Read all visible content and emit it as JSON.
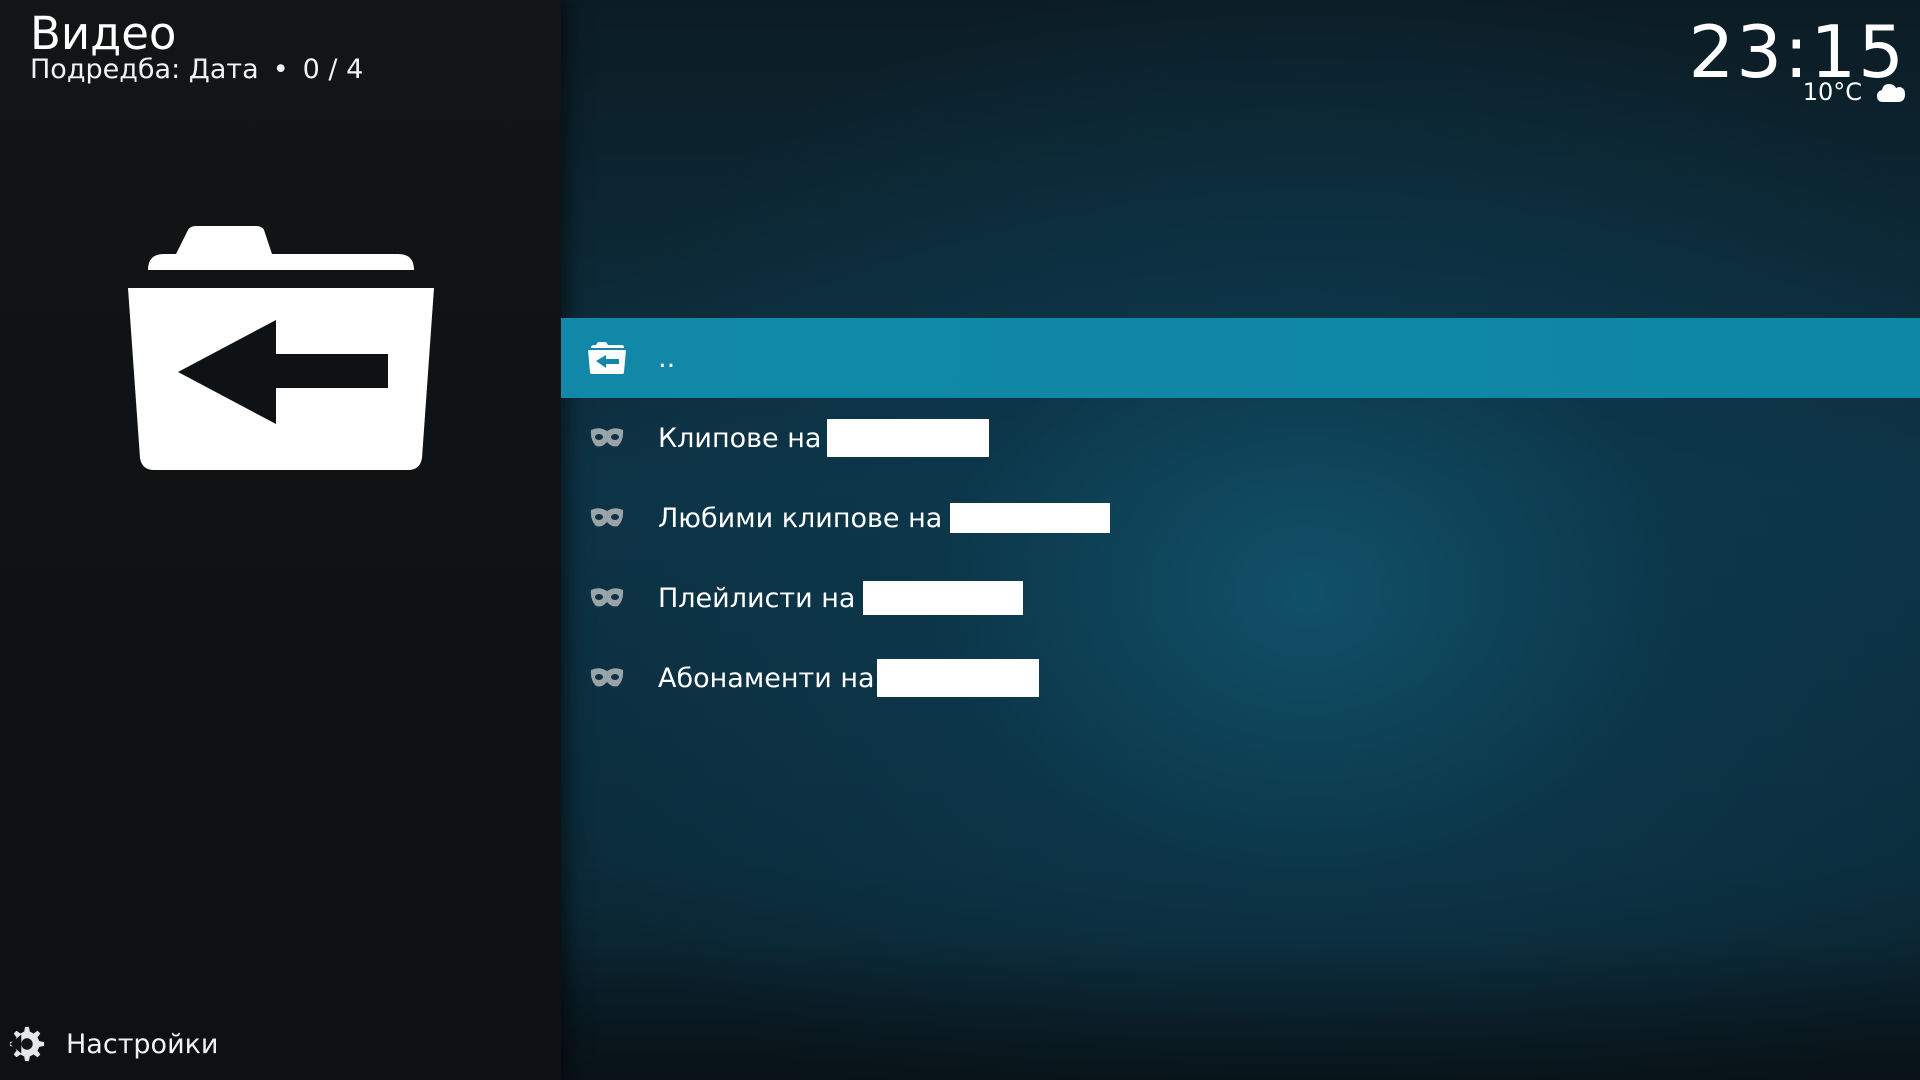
{
  "header": {
    "title": "Видео",
    "sort_label": "Подредба: Дата",
    "separator": "•",
    "position": "0 / 4"
  },
  "clock": {
    "time": "23:15",
    "temperature": "10°C",
    "weather_icon": "cloud-icon"
  },
  "sidebar": {
    "settings_label": "Настройки",
    "settings_icon": "gear-icon",
    "thumbnail_icon": "folder-back-icon"
  },
  "list": {
    "items": [
      {
        "label": "..",
        "icon": "folder-back-icon",
        "selected": true
      },
      {
        "label": "Клипове на",
        "icon": "mask-icon"
      },
      {
        "label": "Любими клипове на",
        "icon": "mask-icon"
      },
      {
        "label": "Плейлисти на",
        "icon": "mask-icon"
      },
      {
        "label": "Абонаменти на",
        "icon": "mask-icon"
      }
    ]
  },
  "colors": {
    "selection": "#1289a9",
    "left_panel": "#121416",
    "background_accent": "#0d3345"
  }
}
